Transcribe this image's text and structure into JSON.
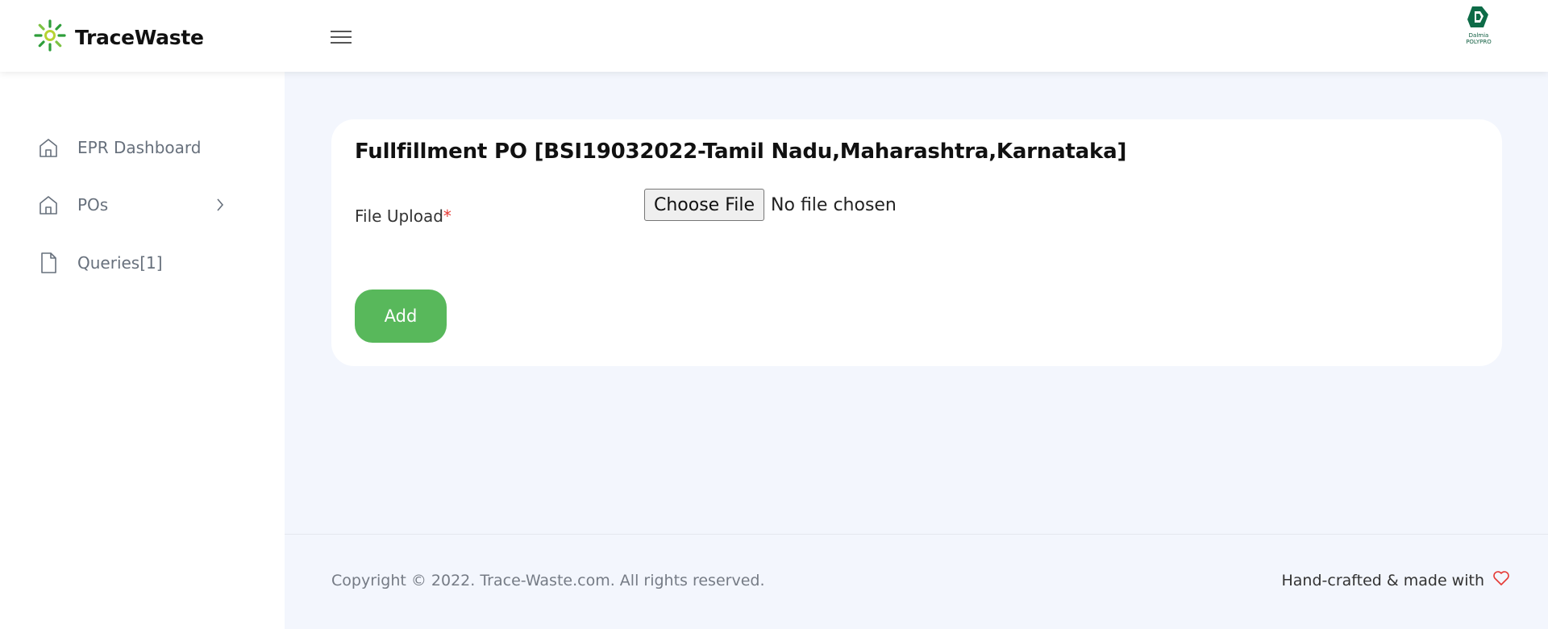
{
  "header": {
    "brand_name": "TraceWaste",
    "brand_icon": "sun-burst-logo-icon",
    "menu_icon": "hamburger-menu-icon",
    "partner_logo": {
      "line1": "Dalmia",
      "line2": "POLYPRO"
    }
  },
  "sidebar": {
    "items": [
      {
        "label": "EPR Dashboard",
        "icon": "home-icon"
      },
      {
        "label": "POs",
        "icon": "home-icon",
        "has_submenu": true
      },
      {
        "label": "Queries[1]",
        "icon": "document-icon"
      }
    ]
  },
  "main": {
    "card_title": "Fullfillment PO [BSI19032022-Tamil Nadu,Maharashtra,Karnataka]",
    "file_upload": {
      "label": "File Upload",
      "required_mark": "*",
      "button_label": "Choose File",
      "status_text": "No file chosen"
    },
    "add_button_label": "Add"
  },
  "footer": {
    "copyright": "Copyright © 2022. Trace-Waste.com. All rights reserved.",
    "credit": "Hand-crafted & made with",
    "credit_icon": "heart-icon"
  },
  "colors": {
    "accent_green": "#58b85b",
    "background": "#f3f6fd",
    "required_red": "#e53935",
    "heart_red": "#e53935"
  }
}
